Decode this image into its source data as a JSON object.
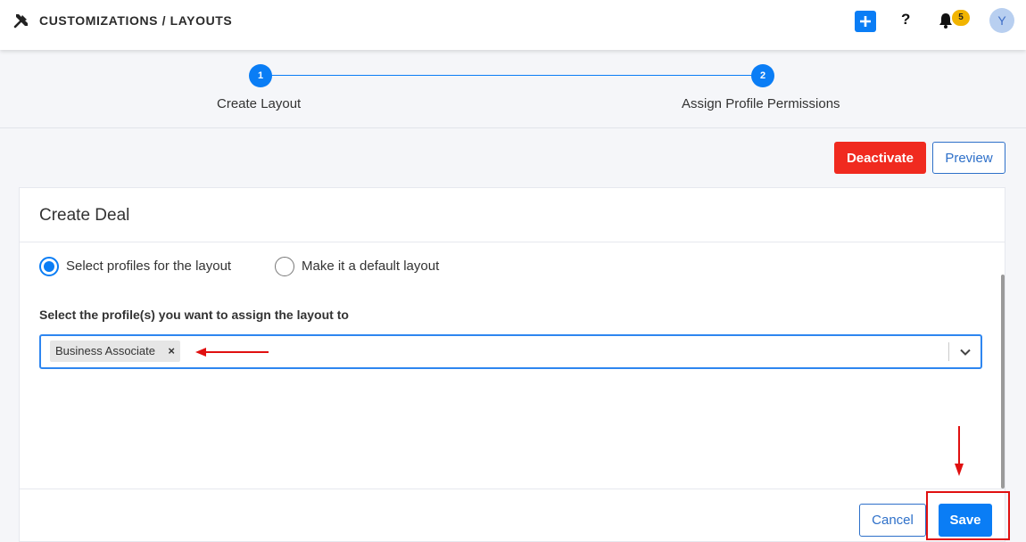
{
  "header": {
    "title": "CUSTOMIZATIONS / LAYOUTS",
    "brand_icon": "tools-icon",
    "add_icon": "plus-icon",
    "help_label": "?",
    "bell_icon": "bell-icon",
    "notification_count": "5",
    "avatar_initial": "Y"
  },
  "stepper": {
    "steps": [
      {
        "number": "1",
        "label": "Create Layout"
      },
      {
        "number": "2",
        "label": "Assign Profile Permissions"
      }
    ]
  },
  "actions": {
    "deactivate_label": "Deactivate",
    "preview_label": "Preview"
  },
  "panel": {
    "title": "Create Deal",
    "options": [
      {
        "label": "Select profiles for the layout",
        "selected": true
      },
      {
        "label": "Make it a default layout",
        "selected": false
      }
    ],
    "field_label": "Select the profile(s) you want to assign the layout to",
    "selected_profiles": [
      "Business Associate"
    ],
    "chip_remove": "×",
    "cancel_label": "Cancel",
    "save_label": "Save"
  },
  "colors": {
    "primary": "#0a7df5",
    "danger": "#f02a1f",
    "annotation": "#e01010",
    "badge": "#f1b400"
  }
}
